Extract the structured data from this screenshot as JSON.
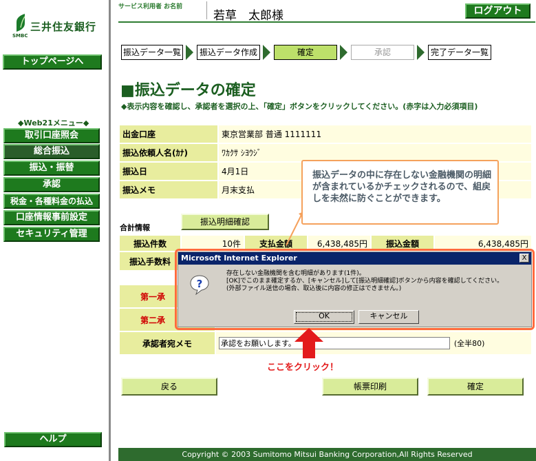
{
  "brand": {
    "name": "三井住友銀行",
    "sub": "SMBC"
  },
  "sidebar": {
    "top_button": "トップページへ",
    "menu_title": "◆Web21メニュー◆",
    "items": [
      "取引口座照会",
      "総合振込",
      "振込・振替",
      "承認",
      "税金・各種料金の払込",
      "口座情報事前設定",
      "セキュリティ管理"
    ],
    "help_button": "ヘルプ"
  },
  "header": {
    "user_label": "サービス利用者 お名前",
    "user_name": "若草　太郎様",
    "logout": "ログアウト"
  },
  "steps": [
    {
      "label": "振込データ一覧",
      "state": "normal"
    },
    {
      "label": "振込データ作成",
      "state": "normal"
    },
    {
      "label": "確定",
      "state": "active"
    },
    {
      "label": "承認",
      "state": "disabled"
    },
    {
      "label": "完了データ一覧",
      "state": "normal"
    }
  ],
  "page_title": "■振込データの確定",
  "instruction": "◆表示内容を確認し、承認者を選択の上、「確定」ボタンをクリックしてください。(赤字は入力必須項目)",
  "info_rows": [
    {
      "label": "出金口座",
      "value": "東京営業部 普通 1111111"
    },
    {
      "label": "振込依頼人名(ｶﾅ)",
      "value": "ﾜｶｸｻ ｼﾖｳｼﾞ"
    },
    {
      "label": "振込日",
      "value": "4月1日"
    },
    {
      "label": "振込メモ",
      "value": "月末支払"
    }
  ],
  "summary": {
    "label": "合計情報",
    "detail_button": "振込明細確認",
    "count_label": "振込件数",
    "count_value": "10件",
    "pay_label": "支払金額",
    "pay_value": "6,438,485円",
    "transfer_label": "振込金額",
    "transfer_value": "6,438,485円",
    "fee_label": "振込手数料"
  },
  "approvers": {
    "first_label": "第一承",
    "second_label": "第二承",
    "memo_label": "承認者宛メモ",
    "memo_value": "承認をお願いします。",
    "memo_hint": "(全半80)"
  },
  "buttons": {
    "back": "戻る",
    "print": "帳票印刷",
    "confirm": "確定"
  },
  "footer": "Copyright © 2003 Sumitomo Mitsui Banking Corporation,All Rights Reserved",
  "callout": "振込データの中に存在しない金融機関の明細が含まれているかチェックされるので、組戻しを未然に防ぐことができます。",
  "dialog": {
    "title": "Microsoft Internet Explorer",
    "close": "X",
    "line1": "存在しない金融機関を含む明細があります(1件)。",
    "line2": "[OK]でこのまま確定するか、[キャンセル]して[振込明細確認]ボタンから内容を確認してください。",
    "line3": "(外部ファイル送信の場合、取込後に内容の修正はできません。)",
    "ok": "OK",
    "cancel": "キャンセル"
  },
  "click_label": "ここをクリック！",
  "colors": {
    "brand_green": "#1e7a1e",
    "dark_green": "#1b5e20",
    "step_active": "#bde06a",
    "label_bg": "#e8ed9e",
    "value_bg": "#fffde0",
    "highlight": "#ff6a3d",
    "click_red": "#e31b1b"
  }
}
